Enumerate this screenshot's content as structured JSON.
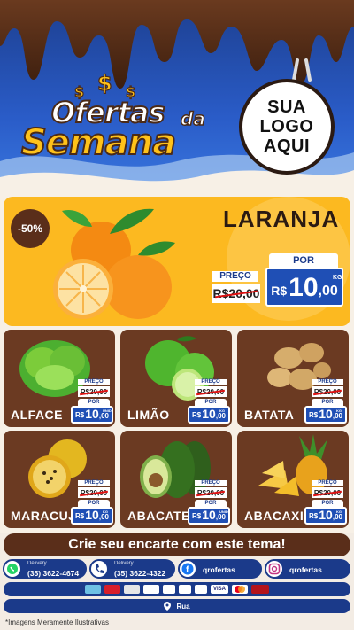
{
  "header": {
    "title_line1": "Ofertas",
    "title_da": "da",
    "title_line2": "Semana",
    "money_symbol": "$",
    "logo_lines": [
      "SUA",
      "LOGO",
      "AQUI"
    ]
  },
  "featured": {
    "discount": "-50%",
    "name": "LARANJA",
    "image_icon": "orange-icon",
    "price": {
      "preco_label": "PREÇO",
      "old_price": "R$20,00",
      "por_label": "POR",
      "currency": "R$",
      "new_int": "10",
      "new_dec": ",00",
      "unit": "KG"
    }
  },
  "products": [
    {
      "name": "ALFACE",
      "icon": "lettuce-icon",
      "preco_label": "PREÇO",
      "old_price": "R$20,00",
      "por_label": "POR",
      "currency": "R$",
      "new_int": "10",
      "new_dec": ",00",
      "unit": "UNID"
    },
    {
      "name": "LIMÃO",
      "icon": "lime-icon",
      "preco_label": "PREÇO",
      "old_price": "R$20,00",
      "por_label": "POR",
      "currency": "R$",
      "new_int": "10",
      "new_dec": ",00",
      "unit": "KG"
    },
    {
      "name": "BATATA",
      "icon": "potato-icon",
      "preco_label": "PREÇO",
      "old_price": "R$20,00",
      "por_label": "POR",
      "currency": "R$",
      "new_int": "10",
      "new_dec": ",00",
      "unit": "KG"
    },
    {
      "name": "MARACUJÁ",
      "icon": "passion-fruit-icon",
      "preco_label": "PREÇO",
      "old_price": "R$20,00",
      "por_label": "POR",
      "currency": "R$",
      "new_int": "10",
      "new_dec": ",00",
      "unit": "KG"
    },
    {
      "name": "ABACATE",
      "icon": "avocado-icon",
      "preco_label": "PREÇO",
      "old_price": "R$20,00",
      "por_label": "POR",
      "currency": "R$",
      "new_int": "10",
      "new_dec": ",00",
      "unit": "UNID"
    },
    {
      "name": "ABACAXI",
      "icon": "pineapple-icon",
      "preco_label": "PREÇO",
      "old_price": "R$20,00",
      "por_label": "POR",
      "currency": "R$",
      "new_int": "10",
      "new_dec": ",00",
      "unit": "KG"
    }
  ],
  "cta": "Crie seu encarte com este tema!",
  "contacts": [
    {
      "icon": "whatsapp-icon",
      "label": "Delivery",
      "value": "(35) 3622-4674"
    },
    {
      "icon": "phone-icon",
      "label": "Delivery",
      "value": "(35) 3622-4322"
    },
    {
      "icon": "facebook-icon",
      "label": "",
      "value": "qrofertas"
    },
    {
      "icon": "instagram-icon",
      "label": "",
      "value": "qrofertas"
    }
  ],
  "payments": [
    "card-icon",
    "banricompras-icon",
    "ticket-icon",
    "sodexo-icon",
    "elo-icon",
    "dinersclub-icon",
    "alelo-icon",
    "visa-icon",
    "mastercard-icon",
    "hipercard-icon"
  ],
  "payment_labels": {
    "visa": "VISA"
  },
  "address": {
    "icon": "location-pin-icon",
    "text": "Rua"
  },
  "note": "*Imagens Meramente Ilustrativas",
  "colors": {
    "brand_blue": "#1b3a8a",
    "price_blue": "#1f4fb5",
    "brown": "#6b3a22",
    "yellow": "#fcb920"
  }
}
